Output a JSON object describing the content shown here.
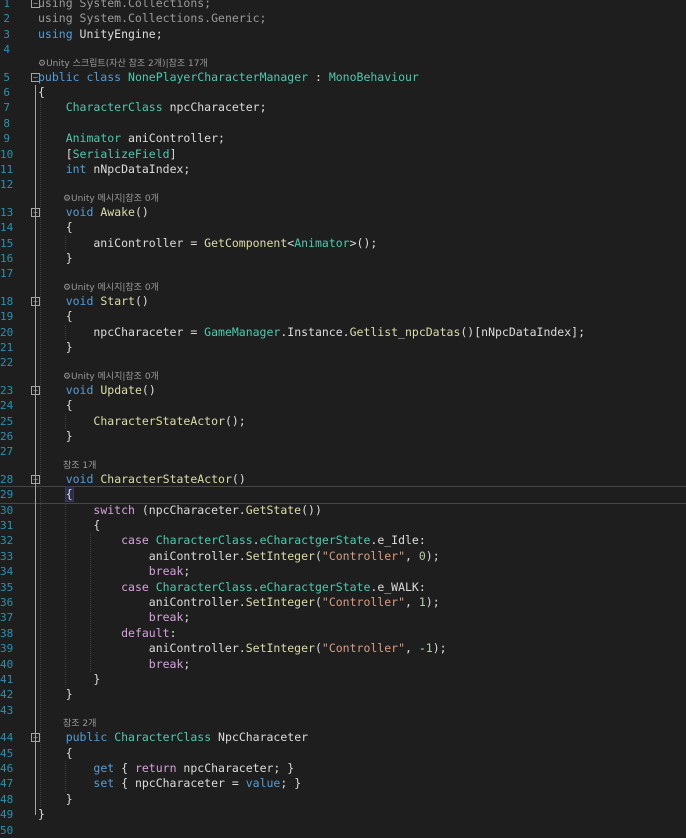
{
  "editor": {
    "lines": [
      {
        "n": "1",
        "kind": "code",
        "segs": [
          {
            "t": "using",
            "c": "kw dim"
          },
          {
            "t": " System.Collections;",
            "c": "dim"
          }
        ]
      },
      {
        "n": "2",
        "kind": "code",
        "segs": [
          {
            "t": "using",
            "c": "kw dim"
          },
          {
            "t": " System.Collections.Generic;",
            "c": "dim"
          }
        ]
      },
      {
        "n": "3",
        "kind": "code",
        "segs": [
          {
            "t": "using",
            "c": "kw"
          },
          {
            "t": " UnityEngine;",
            "c": ""
          }
        ]
      },
      {
        "n": "4",
        "kind": "code",
        "segs": []
      },
      {
        "n": "",
        "kind": "lens",
        "indent": 0,
        "text": "⚙Unity 스크립트(자산 참조 2개)|참조 17개"
      },
      {
        "n": "5",
        "kind": "code",
        "segs": [
          {
            "t": "public class",
            "c": "kw"
          },
          {
            "t": " ",
            "c": ""
          },
          {
            "t": "NonePlayerCharacterManager",
            "c": "ty"
          },
          {
            "t": " : ",
            "c": ""
          },
          {
            "t": "MonoBehaviour",
            "c": "ty"
          }
        ]
      },
      {
        "n": "6",
        "kind": "code",
        "segs": [
          {
            "t": "{",
            "c": ""
          }
        ]
      },
      {
        "n": "7",
        "kind": "code",
        "segs": [
          {
            "t": "    ",
            "c": ""
          },
          {
            "t": "CharacterClass",
            "c": "ty"
          },
          {
            "t": " npcCharaceter;",
            "c": ""
          }
        ]
      },
      {
        "n": "8",
        "kind": "code",
        "segs": []
      },
      {
        "n": "9",
        "kind": "code",
        "segs": [
          {
            "t": "    ",
            "c": ""
          },
          {
            "t": "Animator",
            "c": "ty"
          },
          {
            "t": " aniController;",
            "c": ""
          }
        ]
      },
      {
        "n": "10",
        "kind": "code",
        "segs": [
          {
            "t": "    [",
            "c": ""
          },
          {
            "t": "SerializeField",
            "c": "ty"
          },
          {
            "t": "]",
            "c": ""
          }
        ]
      },
      {
        "n": "11",
        "kind": "code",
        "segs": [
          {
            "t": "    ",
            "c": ""
          },
          {
            "t": "int",
            "c": "kw"
          },
          {
            "t": " nNpcDataIndex;",
            "c": ""
          }
        ]
      },
      {
        "n": "12",
        "kind": "code",
        "segs": []
      },
      {
        "n": "",
        "kind": "lens",
        "indent": 4,
        "text": "⚙Unity 메시지|참조 0개"
      },
      {
        "n": "13",
        "kind": "code",
        "segs": [
          {
            "t": "    ",
            "c": ""
          },
          {
            "t": "void",
            "c": "kw"
          },
          {
            "t": " ",
            "c": ""
          },
          {
            "t": "Awake",
            "c": "mt"
          },
          {
            "t": "()",
            "c": ""
          }
        ]
      },
      {
        "n": "14",
        "kind": "code",
        "segs": [
          {
            "t": "    {",
            "c": ""
          }
        ]
      },
      {
        "n": "15",
        "kind": "code",
        "segs": [
          {
            "t": "        aniController = ",
            "c": ""
          },
          {
            "t": "GetComponent",
            "c": "mt"
          },
          {
            "t": "<",
            "c": ""
          },
          {
            "t": "Animator",
            "c": "ty"
          },
          {
            "t": ">();",
            "c": ""
          }
        ]
      },
      {
        "n": "16",
        "kind": "code",
        "segs": [
          {
            "t": "    }",
            "c": ""
          }
        ]
      },
      {
        "n": "17",
        "kind": "code",
        "segs": []
      },
      {
        "n": "",
        "kind": "lens",
        "indent": 4,
        "text": "⚙Unity 메시지|참조 0개"
      },
      {
        "n": "18",
        "kind": "code",
        "segs": [
          {
            "t": "    ",
            "c": ""
          },
          {
            "t": "void",
            "c": "kw"
          },
          {
            "t": " ",
            "c": ""
          },
          {
            "t": "Start",
            "c": "mt"
          },
          {
            "t": "()",
            "c": ""
          }
        ]
      },
      {
        "n": "19",
        "kind": "code",
        "segs": [
          {
            "t": "    {",
            "c": ""
          }
        ]
      },
      {
        "n": "20",
        "kind": "code",
        "segs": [
          {
            "t": "        npcCharaceter = ",
            "c": ""
          },
          {
            "t": "GameManager",
            "c": "ty"
          },
          {
            "t": ".Instance.",
            "c": ""
          },
          {
            "t": "Getlist_npcDatas",
            "c": "mt"
          },
          {
            "t": "()[nNpcDataIndex];",
            "c": ""
          }
        ]
      },
      {
        "n": "21",
        "kind": "code",
        "segs": [
          {
            "t": "    }",
            "c": ""
          }
        ]
      },
      {
        "n": "22",
        "kind": "code",
        "segs": []
      },
      {
        "n": "",
        "kind": "lens",
        "indent": 4,
        "text": "⚙Unity 메시지|참조 0개"
      },
      {
        "n": "23",
        "kind": "code",
        "segs": [
          {
            "t": "    ",
            "c": ""
          },
          {
            "t": "void",
            "c": "kw"
          },
          {
            "t": " ",
            "c": ""
          },
          {
            "t": "Update",
            "c": "mt"
          },
          {
            "t": "()",
            "c": ""
          }
        ]
      },
      {
        "n": "24",
        "kind": "code",
        "segs": [
          {
            "t": "    {",
            "c": ""
          }
        ]
      },
      {
        "n": "25",
        "kind": "code",
        "segs": [
          {
            "t": "        ",
            "c": ""
          },
          {
            "t": "CharacterStateActor",
            "c": "mt"
          },
          {
            "t": "();",
            "c": ""
          }
        ]
      },
      {
        "n": "26",
        "kind": "code",
        "segs": [
          {
            "t": "    }",
            "c": ""
          }
        ]
      },
      {
        "n": "27",
        "kind": "code",
        "segs": []
      },
      {
        "n": "",
        "kind": "lens",
        "indent": 4,
        "text": "참조 1개"
      },
      {
        "n": "28",
        "kind": "code",
        "segs": [
          {
            "t": "    ",
            "c": ""
          },
          {
            "t": "void",
            "c": "kw"
          },
          {
            "t": " ",
            "c": ""
          },
          {
            "t": "CharacterStateActor",
            "c": "mt"
          },
          {
            "t": "()",
            "c": ""
          }
        ]
      },
      {
        "n": "29",
        "kind": "code",
        "current": true,
        "segs": [
          {
            "t": "    ",
            "c": ""
          },
          {
            "t": "{",
            "c": "bracehl"
          }
        ]
      },
      {
        "n": "30",
        "kind": "code",
        "segs": [
          {
            "t": "        ",
            "c": ""
          },
          {
            "t": "switch",
            "c": "cf"
          },
          {
            "t": " (npcCharaceter.",
            "c": ""
          },
          {
            "t": "GetState",
            "c": "mt"
          },
          {
            "t": "())",
            "c": ""
          }
        ]
      },
      {
        "n": "31",
        "kind": "code",
        "segs": [
          {
            "t": "        {",
            "c": ""
          }
        ]
      },
      {
        "n": "32",
        "kind": "code",
        "segs": [
          {
            "t": "            ",
            "c": ""
          },
          {
            "t": "case",
            "c": "cf"
          },
          {
            "t": " ",
            "c": ""
          },
          {
            "t": "CharacterClass",
            "c": "ty"
          },
          {
            "t": ".",
            "c": ""
          },
          {
            "t": "eCharactgerState",
            "c": "ty"
          },
          {
            "t": ".e_Idle:",
            "c": ""
          }
        ]
      },
      {
        "n": "33",
        "kind": "code",
        "segs": [
          {
            "t": "                aniController.",
            "c": ""
          },
          {
            "t": "SetInteger",
            "c": "mt"
          },
          {
            "t": "(",
            "c": ""
          },
          {
            "t": "\"Controller\"",
            "c": "st"
          },
          {
            "t": ", ",
            "c": ""
          },
          {
            "t": "0",
            "c": "nm"
          },
          {
            "t": ");",
            "c": ""
          }
        ]
      },
      {
        "n": "34",
        "kind": "code",
        "segs": [
          {
            "t": "                ",
            "c": ""
          },
          {
            "t": "break",
            "c": "cf"
          },
          {
            "t": ";",
            "c": ""
          }
        ]
      },
      {
        "n": "35",
        "kind": "code",
        "segs": [
          {
            "t": "            ",
            "c": ""
          },
          {
            "t": "case",
            "c": "cf"
          },
          {
            "t": " ",
            "c": ""
          },
          {
            "t": "CharacterClass",
            "c": "ty"
          },
          {
            "t": ".",
            "c": ""
          },
          {
            "t": "eCharactgerState",
            "c": "ty"
          },
          {
            "t": ".e_WALK:",
            "c": ""
          }
        ]
      },
      {
        "n": "36",
        "kind": "code",
        "segs": [
          {
            "t": "                aniController.",
            "c": ""
          },
          {
            "t": "SetInteger",
            "c": "mt"
          },
          {
            "t": "(",
            "c": ""
          },
          {
            "t": "\"Controller\"",
            "c": "st"
          },
          {
            "t": ", ",
            "c": ""
          },
          {
            "t": "1",
            "c": "nm"
          },
          {
            "t": ");",
            "c": ""
          }
        ]
      },
      {
        "n": "37",
        "kind": "code",
        "segs": [
          {
            "t": "                ",
            "c": ""
          },
          {
            "t": "break",
            "c": "cf"
          },
          {
            "t": ";",
            "c": ""
          }
        ]
      },
      {
        "n": "38",
        "kind": "code",
        "segs": [
          {
            "t": "            ",
            "c": ""
          },
          {
            "t": "default",
            "c": "cf"
          },
          {
            "t": ":",
            "c": ""
          }
        ]
      },
      {
        "n": "39",
        "kind": "code",
        "segs": [
          {
            "t": "                aniController.",
            "c": ""
          },
          {
            "t": "SetInteger",
            "c": "mt"
          },
          {
            "t": "(",
            "c": ""
          },
          {
            "t": "\"Controller\"",
            "c": "st"
          },
          {
            "t": ", -",
            "c": ""
          },
          {
            "t": "1",
            "c": "nm"
          },
          {
            "t": ");",
            "c": ""
          }
        ]
      },
      {
        "n": "40",
        "kind": "code",
        "segs": [
          {
            "t": "                ",
            "c": ""
          },
          {
            "t": "break",
            "c": "cf"
          },
          {
            "t": ";",
            "c": ""
          }
        ]
      },
      {
        "n": "41",
        "kind": "code",
        "segs": [
          {
            "t": "        }",
            "c": ""
          }
        ]
      },
      {
        "n": "42",
        "kind": "code",
        "segs": [
          {
            "t": "    }",
            "c": ""
          }
        ]
      },
      {
        "n": "43",
        "kind": "code",
        "segs": []
      },
      {
        "n": "",
        "kind": "lens",
        "indent": 4,
        "text": "참조 2개"
      },
      {
        "n": "44",
        "kind": "code",
        "segs": [
          {
            "t": "    ",
            "c": ""
          },
          {
            "t": "public",
            "c": "kw"
          },
          {
            "t": " ",
            "c": ""
          },
          {
            "t": "CharacterClass",
            "c": "ty"
          },
          {
            "t": " NpcCharaceter",
            "c": ""
          }
        ]
      },
      {
        "n": "45",
        "kind": "code",
        "segs": [
          {
            "t": "    {",
            "c": ""
          }
        ]
      },
      {
        "n": "46",
        "kind": "code",
        "segs": [
          {
            "t": "        ",
            "c": ""
          },
          {
            "t": "get",
            "c": "kw"
          },
          {
            "t": " { ",
            "c": ""
          },
          {
            "t": "return",
            "c": "cf"
          },
          {
            "t": " npcCharaceter; }",
            "c": ""
          }
        ]
      },
      {
        "n": "47",
        "kind": "code",
        "segs": [
          {
            "t": "        ",
            "c": ""
          },
          {
            "t": "set",
            "c": "kw"
          },
          {
            "t": " { npcCharaceter = ",
            "c": ""
          },
          {
            "t": "value",
            "c": "kw"
          },
          {
            "t": "; }",
            "c": ""
          }
        ]
      },
      {
        "n": "48",
        "kind": "code",
        "segs": [
          {
            "t": "    }",
            "c": ""
          }
        ]
      },
      {
        "n": "49",
        "kind": "code",
        "segs": [
          {
            "t": "}",
            "c": ""
          }
        ]
      },
      {
        "n": "50",
        "kind": "code",
        "segs": []
      }
    ]
  }
}
